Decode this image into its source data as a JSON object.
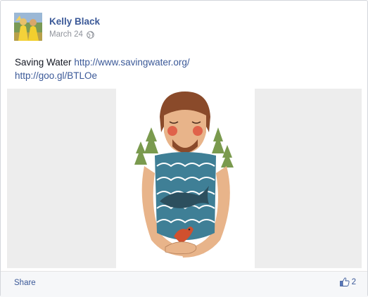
{
  "post": {
    "author": "Kelly Black",
    "date": "March 24",
    "message_text": "Saving Water",
    "link_1": "http://www.savingwater.org/",
    "link_2": "http://goo.gl/BTLOe"
  },
  "footer": {
    "share_label": "Share",
    "like_count": "2"
  },
  "icons": {
    "privacy": "globe-icon",
    "like": "thumbs-up-icon"
  },
  "colors": {
    "link": "#3b5998",
    "text": "#141823",
    "meta": "#90949c",
    "media_bg": "#ededed"
  }
}
